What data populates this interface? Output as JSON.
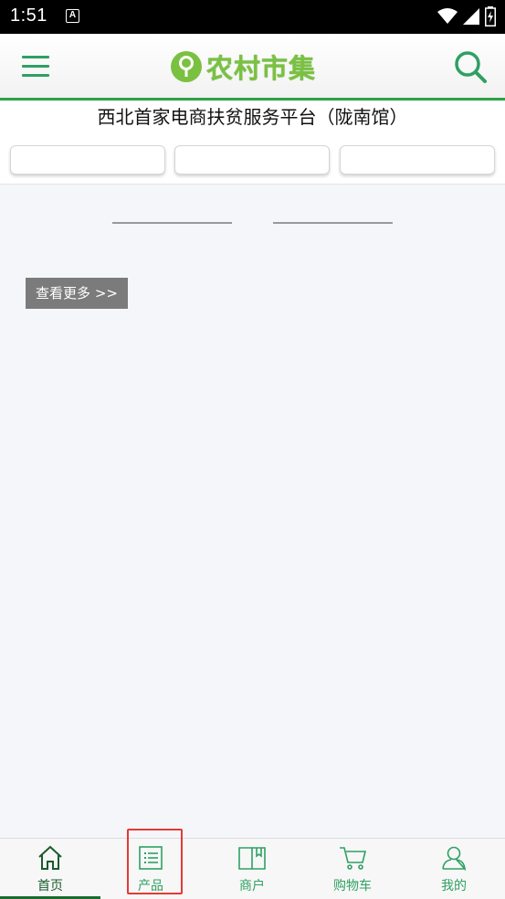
{
  "status_bar": {
    "time": "1:51",
    "notification_glyph": "A"
  },
  "header": {
    "logo_text": "农村市集",
    "brand_color": "#7ac142",
    "accent_color": "#2ea063"
  },
  "subtitle": "西北首家电商扶贫服务平台（陇南馆）",
  "buttons": {
    "more_label": "查看更多 >>"
  },
  "bottom_nav": {
    "items": [
      {
        "label": "首页",
        "icon": "home-icon",
        "active": true
      },
      {
        "label": "产品",
        "icon": "list-icon",
        "active": false
      },
      {
        "label": "商户",
        "icon": "book-icon",
        "active": false
      },
      {
        "label": "购物车",
        "icon": "cart-icon",
        "active": false
      },
      {
        "label": "我的",
        "icon": "user-icon",
        "active": false
      }
    ]
  }
}
